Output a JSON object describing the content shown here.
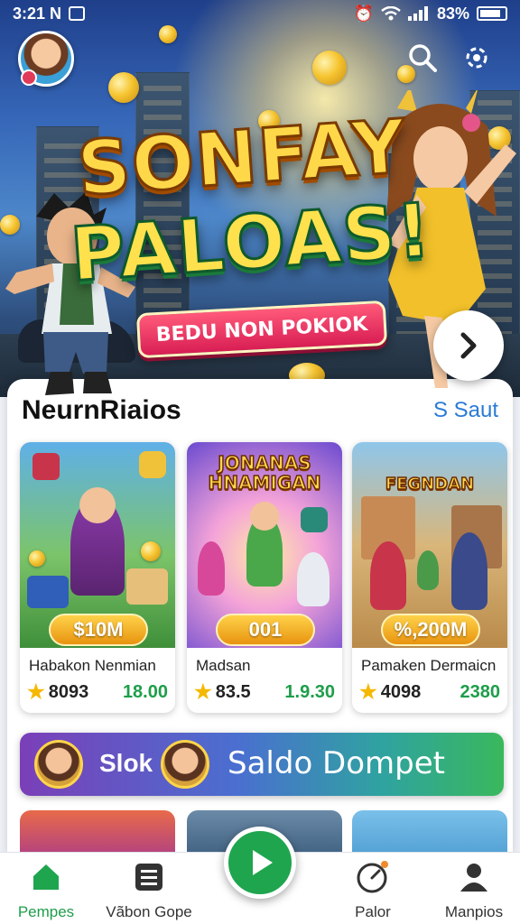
{
  "status_bar": {
    "time": "3:21 N",
    "battery": "83%",
    "battery_level": 0.83
  },
  "hero": {
    "title_line1": "SONFAY",
    "title_line2": "PALOAS!",
    "cta_label": "BEDU NON POKIOK"
  },
  "section": {
    "title": "NeurnRiaios",
    "link": "S Saut"
  },
  "games": [
    {
      "art_title": "",
      "prize": "$10M",
      "name": "Habakon Nenmian",
      "rating": "8093",
      "price": "18.00"
    },
    {
      "art_title": "JONANAS HNAMIGAN",
      "prize": "001",
      "name": "Madsan",
      "rating": "83.5",
      "price": "1.9.30"
    },
    {
      "art_title": "FEGNDAN",
      "prize": "%,200M",
      "name": "Pamaken Dermaicn",
      "rating": "4098",
      "price": "2380"
    }
  ],
  "wallet_banner": {
    "slot_label": "Slok",
    "title": "Saldo Dompet"
  },
  "bottom_nav": {
    "items": [
      {
        "label": "Pempes",
        "icon": "home-icon",
        "active": true
      },
      {
        "label": "Vãbon Gope",
        "icon": "list-icon",
        "active": false
      },
      {
        "label": "Palor",
        "icon": "speedometer-icon",
        "active": false
      },
      {
        "label": "Manpios",
        "icon": "user-icon",
        "active": false
      }
    ]
  },
  "colors": {
    "accent": "#1fa54e",
    "link": "#2a7bd6",
    "cta": "#d81e54"
  }
}
